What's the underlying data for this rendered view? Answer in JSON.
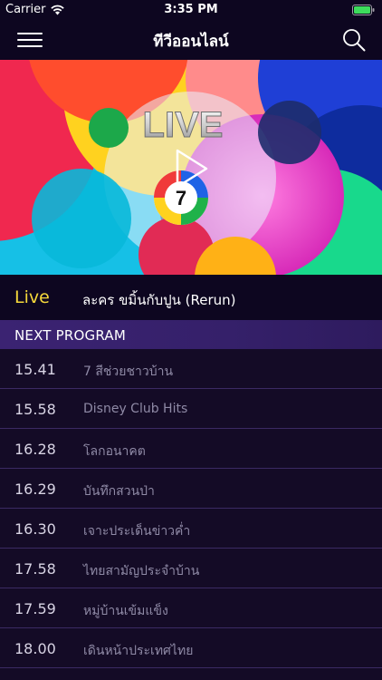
{
  "status_bar": {
    "carrier": "Carrier",
    "time": "3:35 PM",
    "icons": [
      "wifi-icon",
      "battery-icon"
    ]
  },
  "nav": {
    "title": "ทีวีออนไลน์",
    "icons": [
      "menu-icon",
      "search-icon"
    ]
  },
  "hero": {
    "live_text": "LIVE",
    "icon": "play-icon",
    "channel_logo_number": "7"
  },
  "now_playing": {
    "live_label": "Live",
    "title": "ละคร ขมิ้นกับปูน (Rerun)"
  },
  "next_program": {
    "header": "NEXT PROGRAM",
    "items": [
      {
        "time": "15.41",
        "title": "7 สีช่วยชาวบ้าน"
      },
      {
        "time": "15.58",
        "title": "Disney Club Hits"
      },
      {
        "time": "16.28",
        "title": "โลกอนาคต"
      },
      {
        "time": "16.29",
        "title": "บันทึกสวนป่า"
      },
      {
        "time": "16.30",
        "title": "เจาะประเด็นข่าวค่ำ"
      },
      {
        "time": "17.58",
        "title": "ไทยสามัญประจำบ้าน"
      },
      {
        "time": "17.59",
        "title": "หมู่บ้านเข้มแข็ง"
      },
      {
        "time": "18.00",
        "title": "เดินหน้าประเทศไทย"
      }
    ]
  },
  "colors": {
    "background": "#140b26",
    "bar_background": "#0d0620",
    "live_accent": "#f5d83b",
    "header_purple": "#3b2372",
    "divider": "#3b2a63",
    "muted_text": "#8f8aa6"
  }
}
